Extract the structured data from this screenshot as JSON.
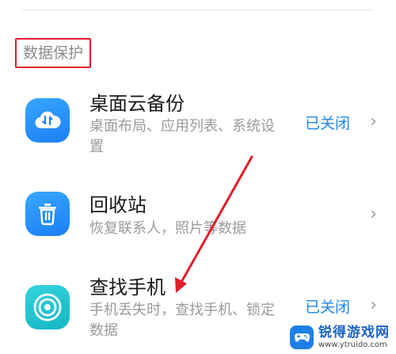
{
  "section": {
    "title": "数据保护"
  },
  "items": [
    {
      "title": "桌面云备份",
      "subtitle": "桌面布局、应用列表、系统设置",
      "status": "已关闭",
      "chevron": "›",
      "icon": "cloud-sync-icon"
    },
    {
      "title": "回收站",
      "subtitle": "恢复联系人，照片等数据",
      "status": "",
      "chevron": "›",
      "icon": "trash-icon"
    },
    {
      "title": "查找手机",
      "subtitle": "手机丢失时，查找手机、锁定数据",
      "status": "已关闭",
      "chevron": "›",
      "icon": "target-icon"
    }
  ],
  "watermark": {
    "name": "锐得游戏网",
    "url": "www.ytruido.com"
  },
  "colors": {
    "annotation": "#e11d2a",
    "status_blue": "#1d86f0"
  }
}
